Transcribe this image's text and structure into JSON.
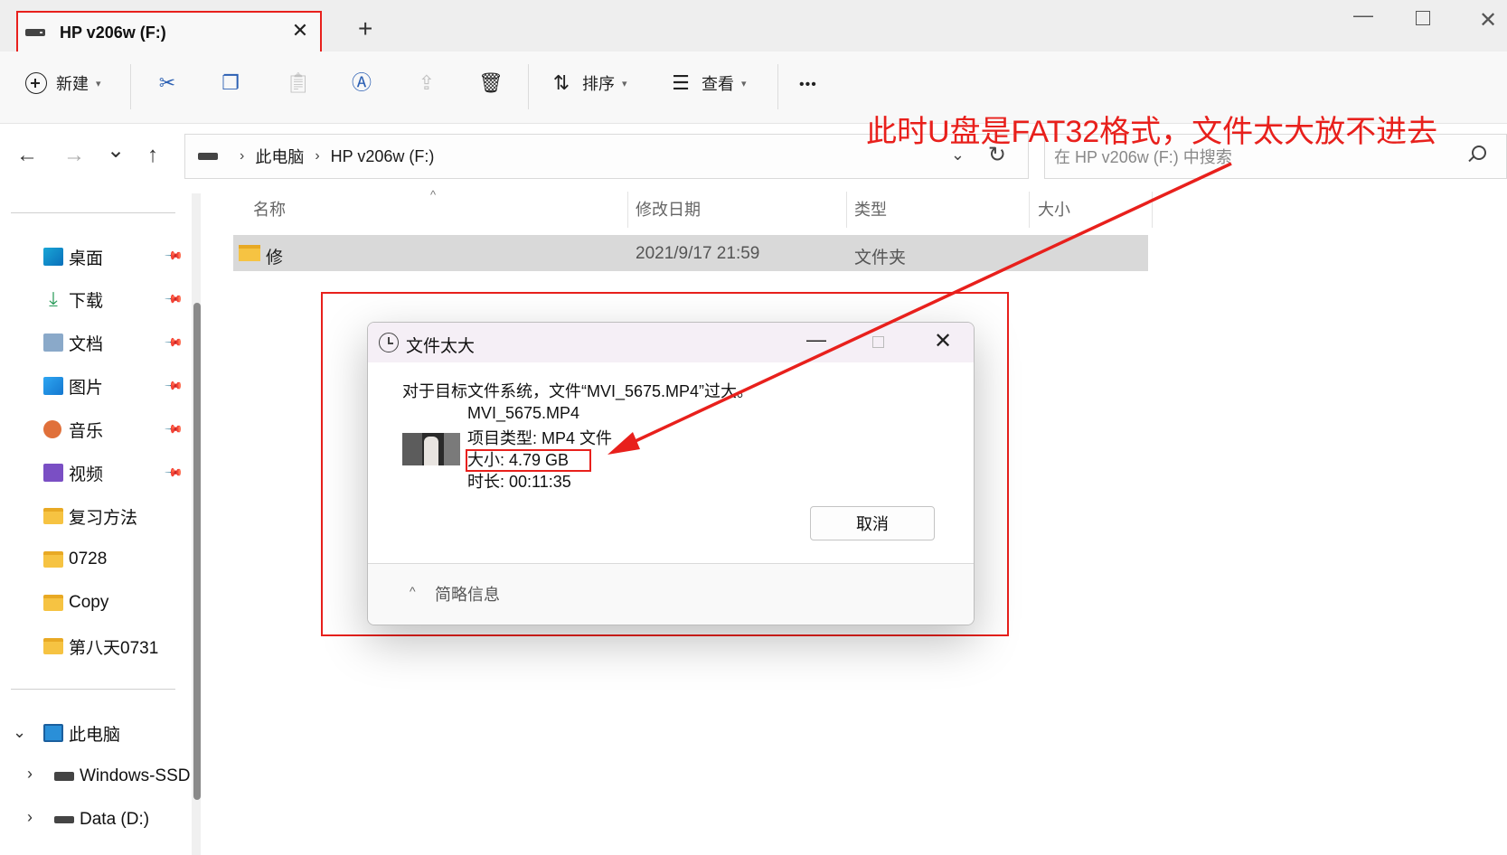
{
  "window": {
    "tab_title": "HP v206w (F:)",
    "close_symbol": "✕",
    "new_tab_symbol": "+",
    "min_symbol": "—",
    "close_window_symbol": "✕"
  },
  "toolbar": {
    "new_label": "新建",
    "sort_label": "排序",
    "view_label": "查看",
    "more_symbol": "•••",
    "icons": [
      "cut-icon",
      "copy-icon",
      "paste-icon",
      "rename-icon",
      "share-icon",
      "delete-icon"
    ]
  },
  "nav": {
    "back": "←",
    "forward": "→",
    "recent": "⌄",
    "up": "↑"
  },
  "address": {
    "crumbs": [
      "此电脑",
      "HP v206w (F:)"
    ],
    "separator": "›",
    "refresh": "↻",
    "dropdown": "⌄"
  },
  "search": {
    "placeholder": "在 HP v206w (F:) 中搜索"
  },
  "sidebar": {
    "quick_access": [
      {
        "label": "桌面",
        "icon": "desktop-icon"
      },
      {
        "label": "下载",
        "icon": "download-icon"
      },
      {
        "label": "文档",
        "icon": "documents-icon"
      },
      {
        "label": "图片",
        "icon": "pictures-icon"
      },
      {
        "label": "音乐",
        "icon": "music-icon"
      },
      {
        "label": "视频",
        "icon": "videos-icon"
      },
      {
        "label": "复习方法",
        "icon": "folder-icon"
      },
      {
        "label": "0728",
        "icon": "folder-icon"
      },
      {
        "label": "Copy",
        "icon": "folder-icon"
      },
      {
        "label": "第八天0731",
        "icon": "folder-icon"
      }
    ],
    "pin_symbol": "📌",
    "this_pc": "此电脑",
    "drives": [
      {
        "label": "Windows-SSD",
        "icon": "windows-drive-icon"
      },
      {
        "label": "Data (D:)",
        "icon": "drive-icon"
      }
    ],
    "expand_symbol": "›",
    "collapse_symbol": "⌄"
  },
  "file_list": {
    "columns": [
      "名称",
      "修改日期",
      "类型",
      "大小"
    ],
    "sort_caret": "^",
    "rows": [
      {
        "name": "修",
        "modified": "2021/9/17 21:59",
        "type": "文件夹",
        "size": ""
      }
    ]
  },
  "dialog": {
    "title": "文件太大",
    "min_symbol": "—",
    "close_symbol": "✕",
    "message": "对于目标文件系统，文件“MVI_5675.MP4”过大。",
    "file_name": "MVI_5675.MP4",
    "file_type": "项目类型: MP4 文件",
    "file_size": "大小: 4.79 GB",
    "duration": "时长: 00:11:35",
    "cancel_label": "取消",
    "footer_caret": "^",
    "footer_label": "简略信息"
  },
  "annotation": {
    "text": "此时U盘是FAT32格式，文件太大放不进去",
    "color": "#e8201c"
  }
}
